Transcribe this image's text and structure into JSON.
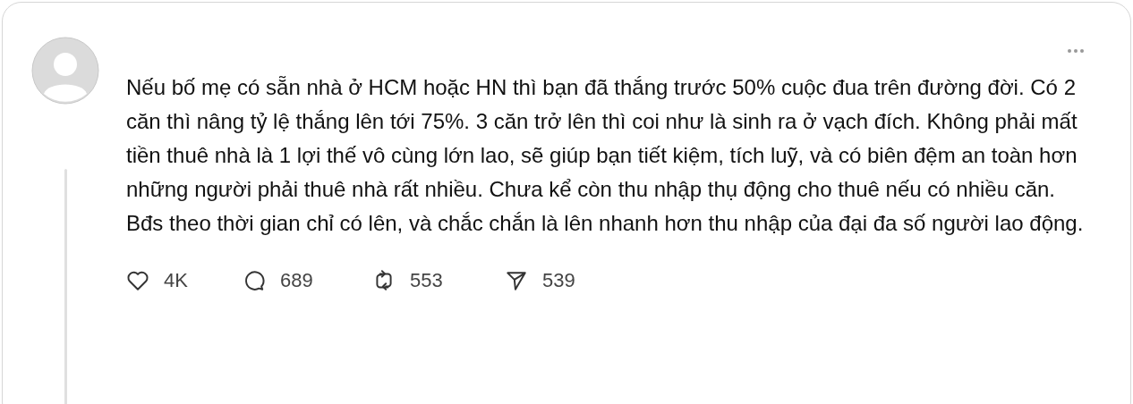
{
  "post": {
    "text": "Nếu bố mẹ có sẵn nhà ở HCM hoặc HN thì bạn đã thắng trước 50% cuộc đua trên đường đời. Có 2 căn thì nâng tỷ lệ thắng lên tới 75%. 3 căn trở lên thì coi như là sinh ra ở vạch đích. Không phải mất tiền thuê nhà là 1 lợi thế vô cùng lớn lao, sẽ giúp bạn tiết kiệm, tích luỹ, và có biên đệm an toàn hơn những người phải thuê nhà rất nhiều. Chưa kể còn thu nhập thụ động cho thuê nếu có nhiều căn. Bđs theo thời gian chỉ có lên, và chắc chắn là lên nhanh hơn thu nhập của đại đa số người lao động.",
    "actions": [
      {
        "kind": "like",
        "count": "4K"
      },
      {
        "kind": "reply",
        "count": "689"
      },
      {
        "kind": "repost",
        "count": "553"
      },
      {
        "kind": "share",
        "count": "539"
      }
    ]
  }
}
